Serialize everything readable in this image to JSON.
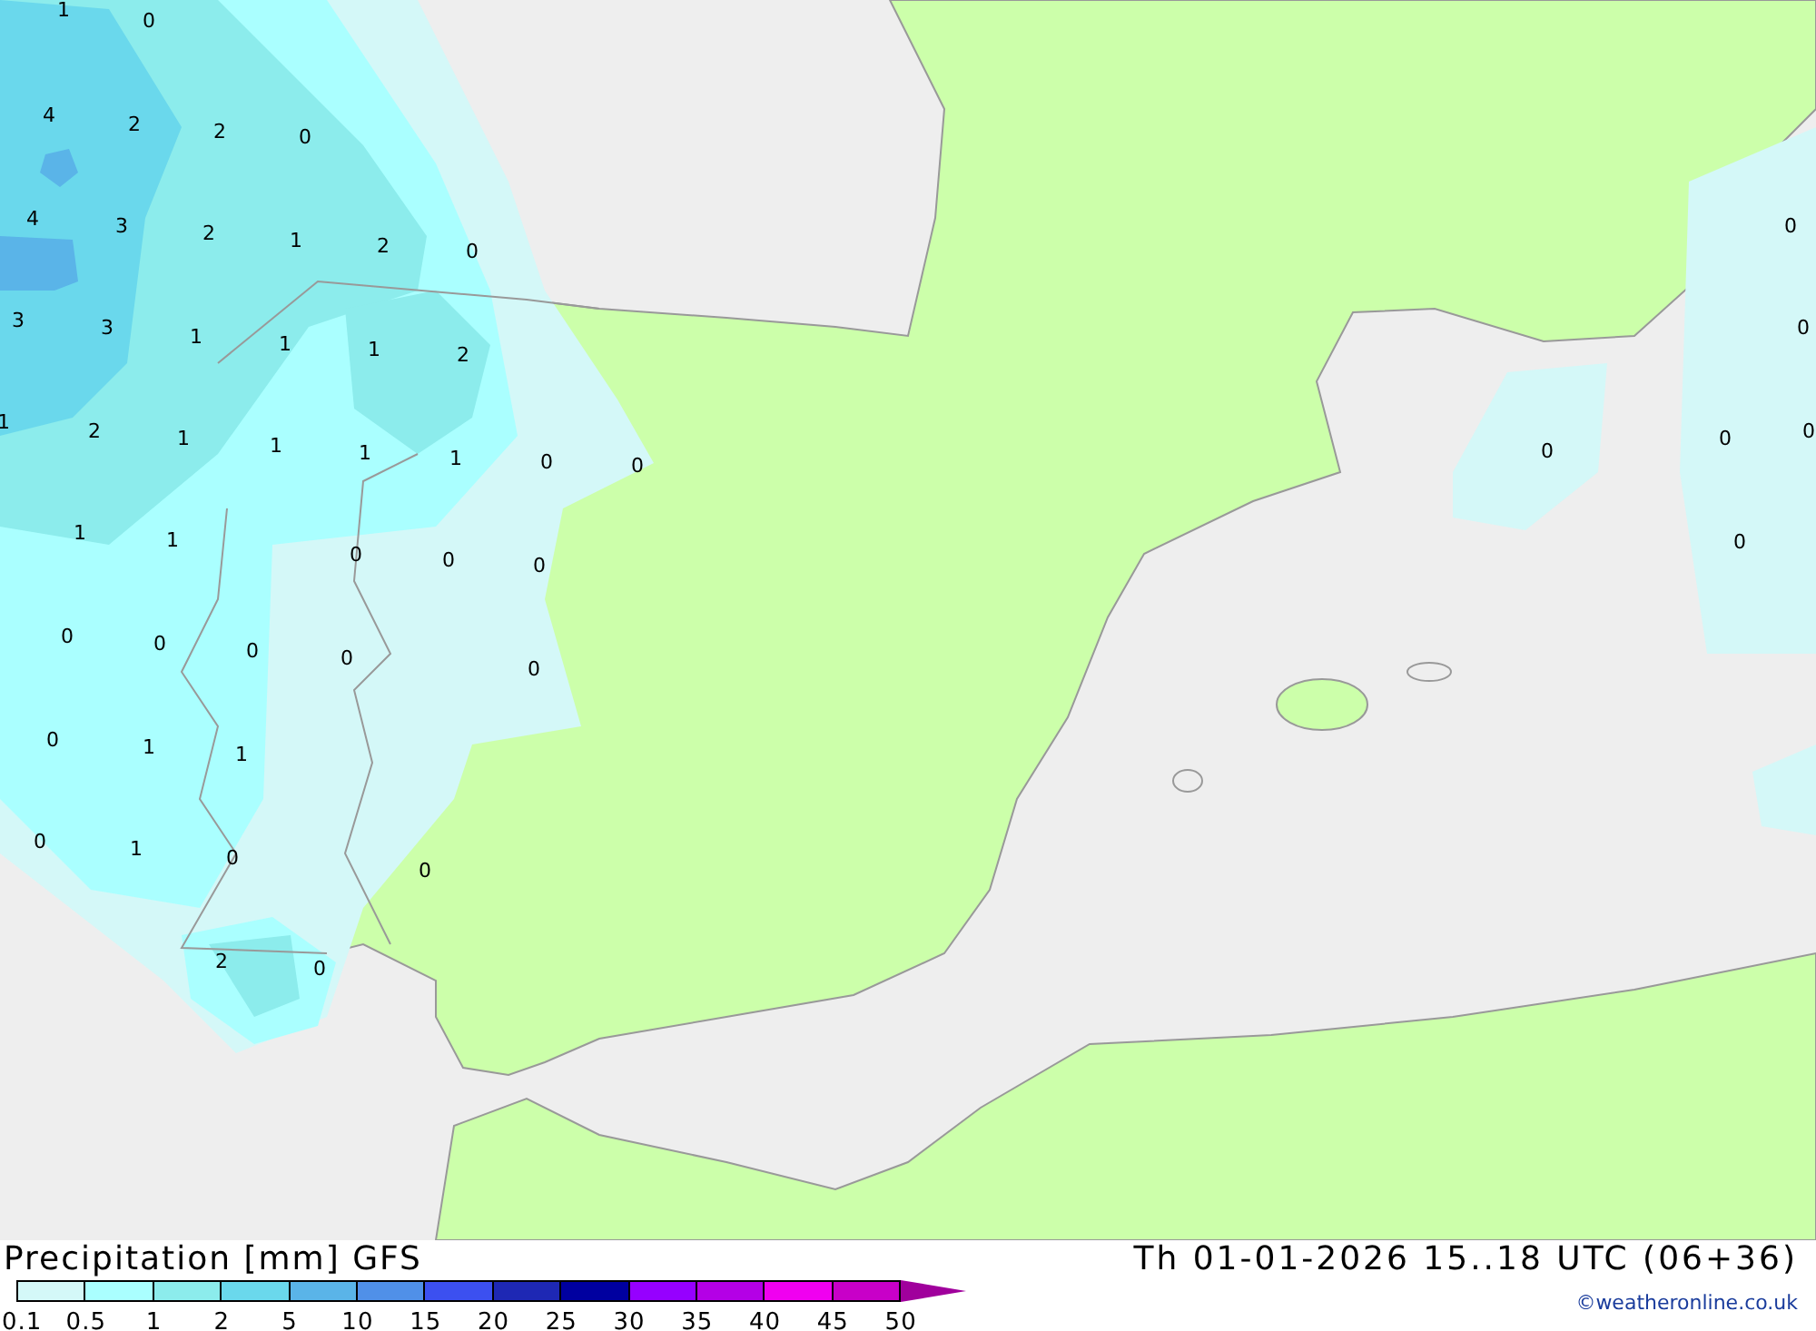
{
  "map": {
    "value_labels": [
      "1",
      "0",
      "4",
      "2",
      "2",
      "0",
      "4",
      "3",
      "2",
      "1",
      "2",
      "0",
      "3",
      "3",
      "1",
      "1",
      "1",
      "2",
      "1",
      "2",
      "1",
      "1",
      "1",
      "1",
      "0",
      "0",
      "1",
      "1",
      "0",
      "0",
      "0",
      "0",
      "0",
      "0",
      "0",
      "0",
      "0",
      "1",
      "1",
      "0",
      "1",
      "0",
      "0",
      "2",
      "0",
      "0",
      "0",
      "0",
      "0",
      "0",
      "0"
    ]
  },
  "legend": {
    "title": "Precipitation [mm] GFS",
    "bins": [
      {
        "kind": "box",
        "color": "#d4f8f8"
      },
      {
        "kind": "box",
        "color": "#aaffff"
      },
      {
        "kind": "box",
        "color": "#8cecec"
      },
      {
        "kind": "box",
        "color": "#6ad8ec"
      },
      {
        "kind": "box",
        "color": "#5ab4e8"
      },
      {
        "kind": "box",
        "color": "#5090e8"
      },
      {
        "kind": "box",
        "color": "#3c50f0"
      },
      {
        "kind": "box",
        "color": "#1e28b4"
      },
      {
        "kind": "box",
        "color": "#0000a0"
      },
      {
        "kind": "box",
        "color": "#9600ff"
      },
      {
        "kind": "box",
        "color": "#b400e6"
      },
      {
        "kind": "box",
        "color": "#f000f0"
      },
      {
        "kind": "box",
        "color": "#c800c8"
      },
      {
        "kind": "arrow",
        "color": "#a0009c"
      }
    ],
    "ticks": [
      "0.1",
      "0.5",
      "1",
      "2",
      "5",
      "10",
      "15",
      "20",
      "25",
      "30",
      "35",
      "40",
      "45",
      "50"
    ]
  },
  "valid_time": "Th 01-01-2026 15..18 UTC (06+36)",
  "credit": "©weatheronline.co.uk"
}
